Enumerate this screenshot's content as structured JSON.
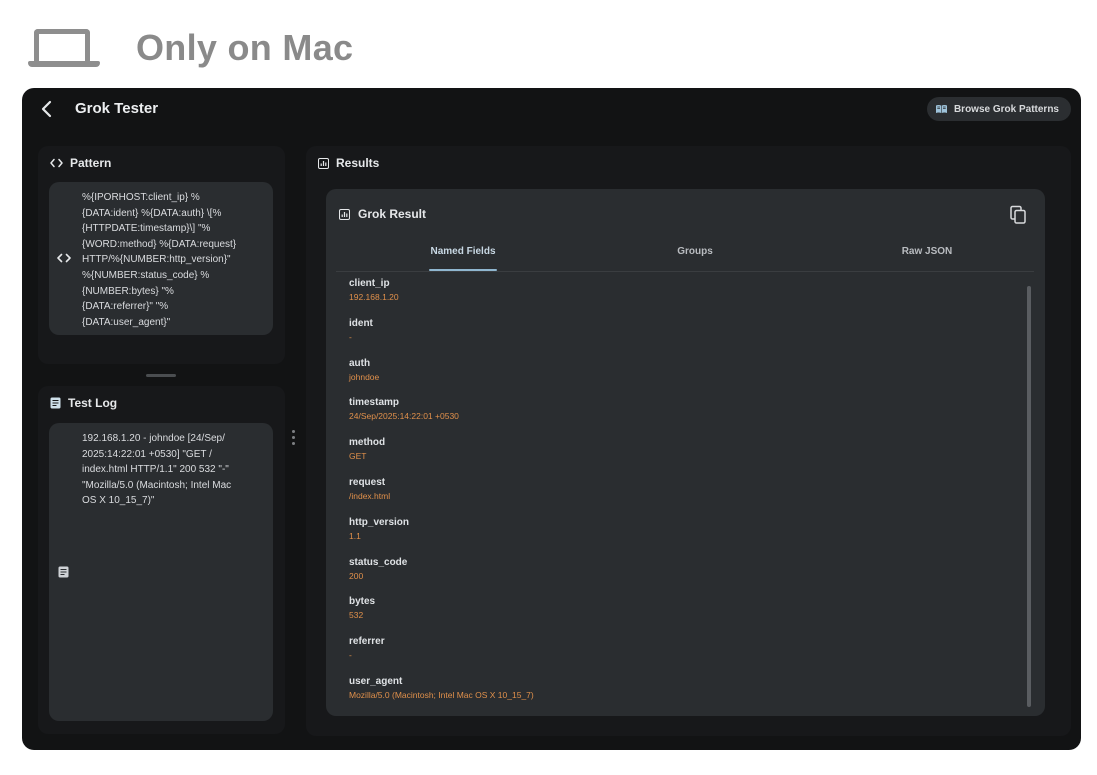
{
  "banner": {
    "icon": "laptop-icon",
    "label": "Only on Mac"
  },
  "app": {
    "title": "Grok Tester",
    "browse_button": "Browse Grok Patterns"
  },
  "pattern_panel": {
    "title": "Pattern",
    "text": "%{IPORHOST:client_ip} %\n{DATA:ident} %{DATA:auth} \\[%\n{HTTPDATE:timestamp}\\] \"%\n{WORD:method} %{DATA:request}\nHTTP/%{NUMBER:http_version}\"\n%{NUMBER:status_code} %\n{NUMBER:bytes} \"%\n{DATA:referrer}\" \"%\n{DATA:user_agent}\""
  },
  "test_log_panel": {
    "title": "Test Log",
    "text": "192.168.1.20 - johndoe [24/Sep/\n2025:14:22:01 +0530] \"GET /\nindex.html HTTP/1.1\" 200 532 \"-\"\n\"Mozilla/5.0 (Macintosh; Intel Mac\nOS X 10_15_7)\""
  },
  "results_panel": {
    "title": "Results",
    "card_title": "Grok Result",
    "tabs": [
      {
        "label": "Named Fields",
        "active": true
      },
      {
        "label": "Groups",
        "active": false
      },
      {
        "label": "Raw JSON",
        "active": false
      }
    ],
    "fields": [
      {
        "name": "client_ip",
        "value": "192.168.1.20"
      },
      {
        "name": "ident",
        "value": "-"
      },
      {
        "name": "auth",
        "value": "johndoe"
      },
      {
        "name": "timestamp",
        "value": "24/Sep/2025:14:22:01 +0530"
      },
      {
        "name": "method",
        "value": "GET"
      },
      {
        "name": "request",
        "value": "/index.html"
      },
      {
        "name": "http_version",
        "value": "1.1"
      },
      {
        "name": "status_code",
        "value": "200"
      },
      {
        "name": "bytes",
        "value": "532"
      },
      {
        "name": "referrer",
        "value": "-"
      },
      {
        "name": "user_agent",
        "value": "Mozilla/5.0 (Macintosh; Intel Mac OS X 10_15_7)"
      }
    ]
  },
  "colors": {
    "app_background": "#121314",
    "panel_background": "#17181a",
    "box_background": "#2a2d30",
    "field_value": "#e0904b",
    "active_tab_indicator": "#8fb6cf"
  }
}
